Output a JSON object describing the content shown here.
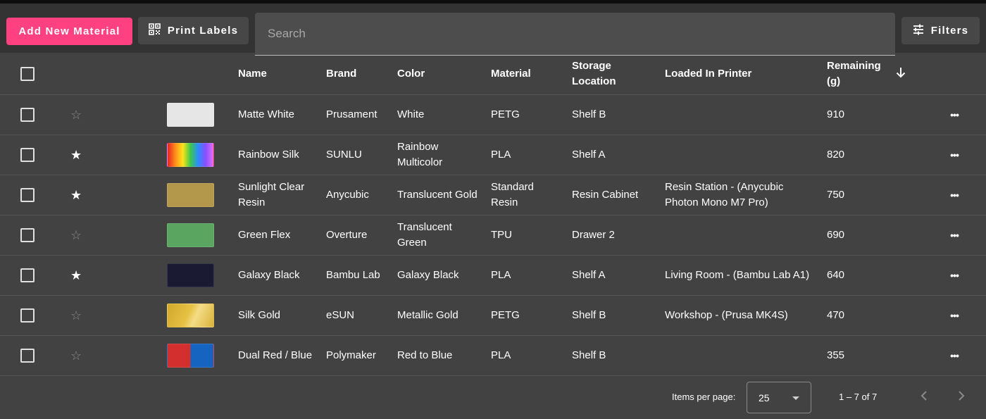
{
  "toolbar": {
    "add_label": "Add New Material",
    "print_label": "Print Labels",
    "print_icon": "qr-code-icon",
    "search_placeholder": "Search",
    "filters_label": "Filters",
    "filters_icon": "tune-icon",
    "accent_color": "#ff4081"
  },
  "table": {
    "headers": {
      "name": "Name",
      "brand": "Brand",
      "color": "Color",
      "material": "Material",
      "storage": "Storage Location",
      "loaded": "Loaded In Printer",
      "remaining": "Remaining (g)"
    },
    "sort": {
      "column": "remaining",
      "direction": "descending",
      "icon": "arrow-down-icon"
    },
    "rows": [
      {
        "favorite": false,
        "swatch": "linear-gradient(#e6e6e6,#e6e6e6)",
        "name": "Matte White",
        "brand": "Prusament",
        "color": "White",
        "material": "PETG",
        "storage": "Shelf B",
        "loaded": "",
        "remaining": "910"
      },
      {
        "favorite": true,
        "swatch": "linear-gradient(90deg,#e52222,#ff8c1a,#ffe21a,#3cc94a,#2b8cff,#8a4dff,#e070ff)",
        "name": "Rainbow Silk",
        "brand": "SUNLU",
        "color": "Rainbow Multicolor",
        "material": "PLA",
        "storage": "Shelf A",
        "loaded": "",
        "remaining": "820"
      },
      {
        "favorite": true,
        "swatch": "linear-gradient(#b3974a,#b3974a)",
        "name": "Sunlight Clear Resin",
        "brand": "Anycubic",
        "color": "Translucent Gold",
        "material": "Standard Resin",
        "storage": "Resin Cabinet",
        "loaded": "Resin Station - (Anycubic Photon Mono M7 Pro)",
        "remaining": "750"
      },
      {
        "favorite": false,
        "swatch": "linear-gradient(#5aa660,#5aa660)",
        "name": "Green Flex",
        "brand": "Overture",
        "color": "Translucent Green",
        "material": "TPU",
        "storage": "Drawer 2",
        "loaded": "",
        "remaining": "690"
      },
      {
        "favorite": true,
        "swatch": "linear-gradient(#1a1a33,#1a1a33)",
        "name": "Galaxy Black",
        "brand": "Bambu Lab",
        "color": "Galaxy Black",
        "material": "PLA",
        "storage": "Shelf A",
        "loaded": "Living Room - (Bambu Lab A1)",
        "remaining": "640"
      },
      {
        "favorite": false,
        "swatch": "linear-gradient(115deg,#d1a82a 0%,#e6c244 45%,#f4dc86 60%,#d9b23a 100%)",
        "name": "Silk Gold",
        "brand": "eSUN",
        "color": "Metallic Gold",
        "material": "PETG",
        "storage": "Shelf B",
        "loaded": "Workshop - (Prusa MK4S)",
        "remaining": "470"
      },
      {
        "favorite": false,
        "swatch": "linear-gradient(90deg,#d32f2f 0%,#d32f2f 50%,#1565c0 50%,#1565c0 100%)",
        "name": "Dual Red / Blue",
        "brand": "Polymaker",
        "color": "Red to Blue",
        "material": "PLA",
        "storage": "Shelf B",
        "loaded": "",
        "remaining": "355"
      }
    ]
  },
  "paginator": {
    "items_per_page_label": "Items per page:",
    "items_per_page_value": "25",
    "range_label": "1 – 7 of 7"
  }
}
